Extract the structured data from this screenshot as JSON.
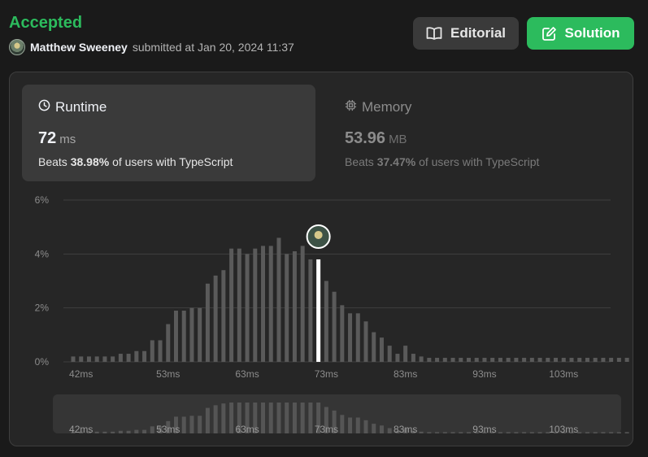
{
  "submission": {
    "status": "Accepted",
    "user_name": "Matthew Sweeney",
    "submitted_text": "submitted at Jan 20, 2024 11:37"
  },
  "buttons": {
    "editorial_label": "Editorial",
    "solution_label": "Solution"
  },
  "runtime": {
    "label": "Runtime",
    "value": "72",
    "unit": "ms",
    "beats_prefix": "Beats",
    "beats_pct": "38.98%",
    "beats_suffix": "of users with TypeScript"
  },
  "memory": {
    "label": "Memory",
    "value": "53.96",
    "unit": "MB",
    "beats_prefix": "Beats",
    "beats_pct": "37.47%",
    "beats_suffix": "of users with TypeScript"
  },
  "colors": {
    "accepted": "#2cbb5d",
    "bar": "#5a5a5a",
    "highlight_bar": "#ffffff"
  },
  "chart_data": {
    "type": "bar",
    "y_ticks": [
      "0%",
      "2%",
      "4%",
      "6%"
    ],
    "ylim": [
      0,
      6
    ],
    "x_ticks": [
      "42ms",
      "53ms",
      "63ms",
      "73ms",
      "83ms",
      "93ms",
      "103ms"
    ],
    "x_tick_values": [
      42,
      53,
      63,
      73,
      83,
      93,
      103
    ],
    "x_start": 41,
    "x_step": 1,
    "values": [
      0.2,
      0.2,
      0.2,
      0.2,
      0.2,
      0.2,
      0.3,
      0.3,
      0.4,
      0.4,
      0.8,
      0.8,
      1.4,
      1.9,
      1.9,
      2.0,
      2.0,
      2.9,
      3.2,
      3.4,
      4.2,
      4.2,
      4.0,
      4.2,
      4.3,
      4.3,
      4.6,
      4.0,
      4.1,
      4.3,
      3.8,
      3.8,
      3.0,
      2.6,
      2.1,
      1.8,
      1.8,
      1.5,
      1.1,
      0.9,
      0.6,
      0.3,
      0.6,
      0.3,
      0.2,
      0.15,
      0.15,
      0.15,
      0.15,
      0.15,
      0.15,
      0.15,
      0.15,
      0.15,
      0.15,
      0.15,
      0.15,
      0.15,
      0.15,
      0.15,
      0.15,
      0.15,
      0.15,
      0.15,
      0.15,
      0.15,
      0.15,
      0.15,
      0.15,
      0.15,
      0.15
    ],
    "highlight_x": 72,
    "grid": true
  }
}
